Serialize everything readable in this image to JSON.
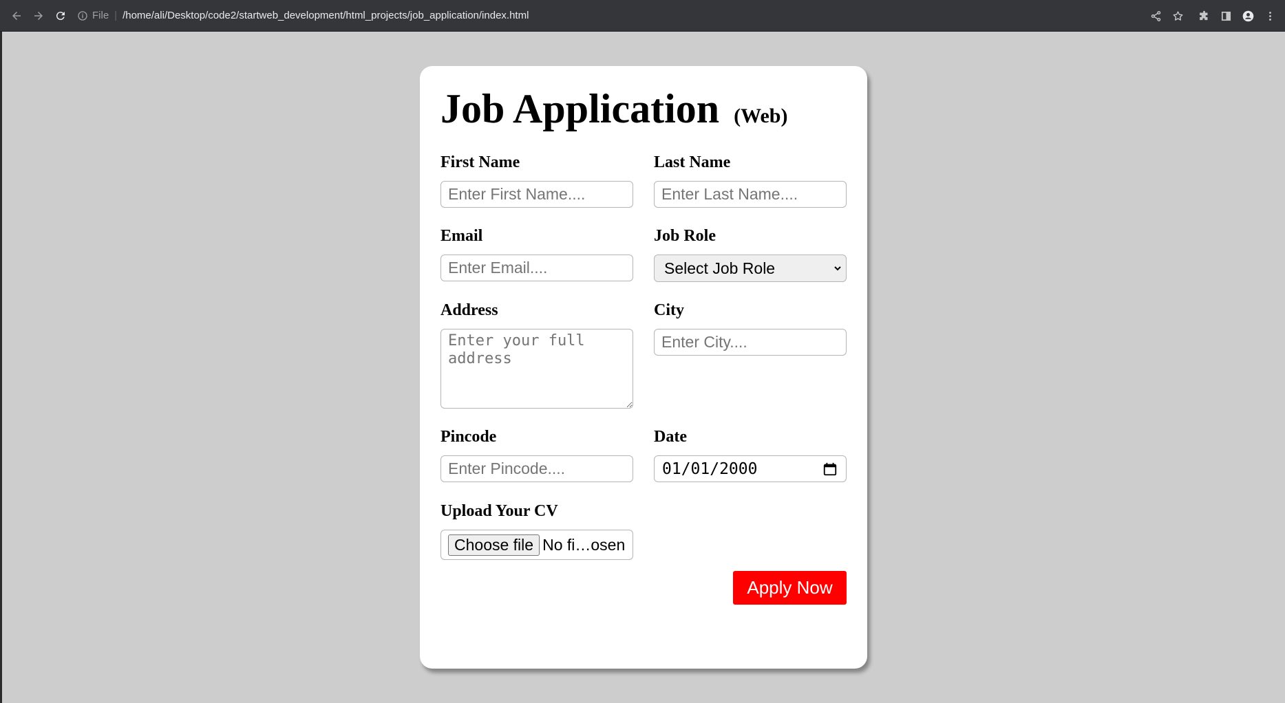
{
  "browser": {
    "file_label": "File",
    "separator": "|",
    "url": "/home/ali/Desktop/code2/startweb_development/html_projects/job_application/index.html"
  },
  "form": {
    "title": "Job Application",
    "subtitle": "(Web)",
    "first_name": {
      "label": "First Name",
      "placeholder": "Enter First Name...."
    },
    "last_name": {
      "label": "Last Name",
      "placeholder": "Enter Last Name...."
    },
    "email": {
      "label": "Email",
      "placeholder": "Enter Email...."
    },
    "job_role": {
      "label": "Job Role",
      "selected": "Select Job Role"
    },
    "address": {
      "label": "Address",
      "placeholder": "Enter your full address"
    },
    "city": {
      "label": "City",
      "placeholder": "Enter City...."
    },
    "pincode": {
      "label": "Pincode",
      "placeholder": "Enter Pincode...."
    },
    "date": {
      "label": "Date",
      "value": "01/01/2000"
    },
    "cv": {
      "label": "Upload Your CV",
      "button": "Choose file",
      "status": "No fi…osen"
    },
    "submit_label": "Apply Now"
  },
  "colors": {
    "page_bg": "#cdcdcd",
    "card_bg": "#ffffff",
    "accent": "#ff0000",
    "chrome_bg": "#35363a"
  }
}
